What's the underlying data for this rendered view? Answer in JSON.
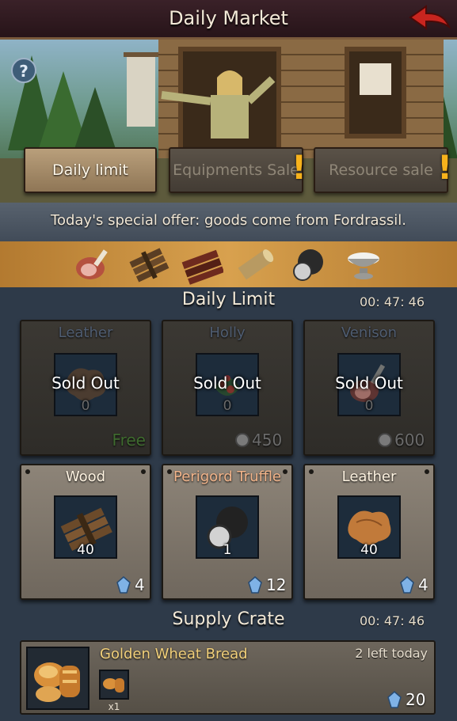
{
  "header": {
    "title": "Daily Market",
    "back_icon": "back-arrow-icon"
  },
  "tabs": {
    "daily_limit": "Daily limit",
    "equipments_sale": "Equipments Sale",
    "resource_sale": "Resource sale",
    "alert_glyph": "!"
  },
  "offer": {
    "text": "Today's special offer: goods come from Fordrassil.",
    "goods_icons": [
      "venison-icon",
      "wood-icon",
      "brown-wood-icon",
      "log-icon",
      "truffle-icon",
      "salt-bowl-icon"
    ]
  },
  "daily_limit": {
    "title": "Daily Limit",
    "timer": "00: 47: 46",
    "sold_out_label": "Sold Out",
    "items": [
      {
        "name": "Leather",
        "qty": "0",
        "price": "Free",
        "currency_icon": "",
        "sold_out": true
      },
      {
        "name": "Holly",
        "qty": "0",
        "price": "450",
        "currency_icon": "stone-coin-icon",
        "sold_out": true
      },
      {
        "name": "Venison",
        "qty": "0",
        "price": "600",
        "currency_icon": "stone-coin-icon",
        "sold_out": true
      },
      {
        "name": "Wood",
        "qty": "40",
        "price": "4",
        "currency_icon": "crystal-icon",
        "sold_out": false
      },
      {
        "name": "Perigord Truffle",
        "qty": "1",
        "price": "12",
        "currency_icon": "crystal-icon",
        "sold_out": false
      },
      {
        "name": "Leather",
        "qty": "40",
        "price": "4",
        "currency_icon": "crystal-icon",
        "sold_out": false
      }
    ]
  },
  "supply_crate": {
    "title": "Supply Crate",
    "timer": "00: 47: 46",
    "item_name": "Golden Wheat Bread",
    "remaining": "2 left today",
    "sub_qty": "x1",
    "price": "20",
    "currency_icon": "crystal-icon"
  },
  "colors": {
    "accent_gold": "#d8a14e",
    "truffle_name": "#f2b48a",
    "free_text": "#3f6b2f"
  }
}
